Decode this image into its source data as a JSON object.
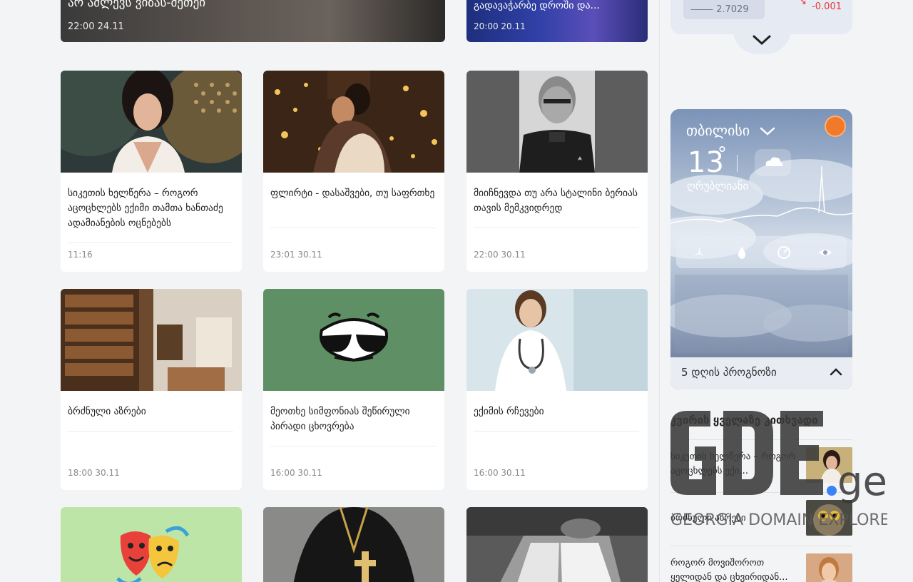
{
  "top_cards": [
    {
      "title": "არ აძლევს ვიზას-მეთეი",
      "date": "22:00 24.11"
    },
    {
      "title": "გადავაჭარბე დროში და...",
      "date": "20:00 20.11"
    }
  ],
  "articles": [
    {
      "title": "სიკეთის ხელწერა – როგორ აცოცხლებს ექიმი თამთა ხანთაძე ადამიანების ოცნებებს",
      "date": "11:16"
    },
    {
      "title": "ფლირტი - დასაშვები, თუ საფრთხე",
      "date": "23:01 30.11"
    },
    {
      "title": "მიიჩნევდა თუ არა სტალინი ბერიას თავის მემკვიდრედ",
      "date": "22:00 30.11"
    },
    {
      "title": "ბრძნული აზრები",
      "date": "18:00 30.11"
    },
    {
      "title": "მეოთხე სიმფონიას შეწირული პირადი ცხოვრება",
      "date": "16:00 30.11"
    },
    {
      "title": "ექიმის რჩევები",
      "date": "16:00 30.11"
    },
    {
      "title": "",
      "date": ""
    },
    {
      "title": "",
      "date": ""
    },
    {
      "title": "",
      "date": ""
    }
  ],
  "currency": {
    "rate": "2.7029",
    "change": "-0.001",
    "up_color": "#e53935"
  },
  "weather": {
    "city": "თბილისი",
    "temperature": "13",
    "degree_symbol": "°",
    "condition": "ღრუბლიანი",
    "forecast_label": "5 დღის პროგნოზი",
    "stat_icons": [
      "wind-icon",
      "humidity-icon",
      "pressure-icon",
      "visibility-icon"
    ]
  },
  "week_popular": {
    "title": "კვირის ყველაზე კითხვადი",
    "items": [
      {
        "title": "სიკეთის ხელწერა – როგორ აცოცხლებს ექი..."
      },
      {
        "title": "ბრძნული აზრები"
      },
      {
        "title": "როგორ მოვიშოროთ ყელიდან და ცხვირიდან..."
      }
    ]
  },
  "watermark": {
    "logo": "GDE.ge",
    "tagline": "GEORGIA DOMAIN EXPLORER"
  }
}
